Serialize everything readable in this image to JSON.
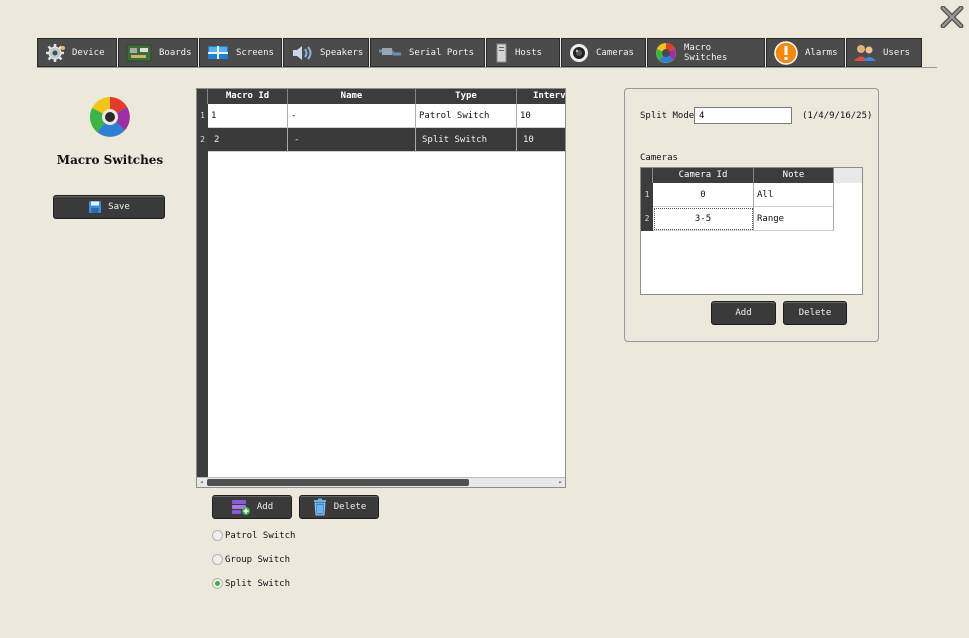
{
  "toolbar": {
    "items": [
      {
        "label": "Device",
        "icon": "gear-icon"
      },
      {
        "label": "Boards",
        "icon": "circuit-board-icon"
      },
      {
        "label": "Screens",
        "icon": "screen-icon"
      },
      {
        "label": "Speakers",
        "icon": "speaker-icon"
      },
      {
        "label": "Serial Ports",
        "icon": "serial-cable-icon"
      },
      {
        "label": "Hosts",
        "icon": "server-tower-icon"
      },
      {
        "label": "Cameras",
        "icon": "camera-lens-icon"
      },
      {
        "label": "Macro Switches",
        "icon": "macro-switch-icon"
      },
      {
        "label": "Alarms",
        "icon": "alarm-exclamation-icon"
      },
      {
        "label": "Users",
        "icon": "users-icon"
      }
    ]
  },
  "left": {
    "title": "Macro Switches",
    "save_label": "Save"
  },
  "macro_table": {
    "columns": [
      "Macro Id",
      "Name",
      "Type",
      "Interv"
    ],
    "rows": [
      {
        "num": "1",
        "id": "1",
        "name": "-",
        "type": "Patrol Switch",
        "interval": "10"
      },
      {
        "num": "2",
        "id": "2",
        "name": "-",
        "type": "Split Switch",
        "interval": "10"
      }
    ],
    "selected_row": 2
  },
  "buttons": {
    "add_label": "Add",
    "delete_label": "Delete"
  },
  "switch_types": {
    "options": [
      "Patrol Switch",
      "Group Switch",
      "Split Switch"
    ],
    "selected": "Split Switch"
  },
  "split": {
    "label": "Split Mode",
    "value": "4",
    "hint": "(1/4/9/16/25)"
  },
  "cameras": {
    "label": "Cameras",
    "columns": [
      "Camera Id",
      "Note"
    ],
    "rows": [
      {
        "num": "1",
        "camera_id": "0",
        "note": "All"
      },
      {
        "num": "2",
        "camera_id": "3-5",
        "note": "Range"
      }
    ],
    "add_label": "Add",
    "delete_label": "Delete"
  },
  "colors": {
    "background": "#ece9dc",
    "toolbar": "#4b4b4b",
    "button_dark": "#3a3a3a",
    "radio_checked": "#3cb43c"
  }
}
